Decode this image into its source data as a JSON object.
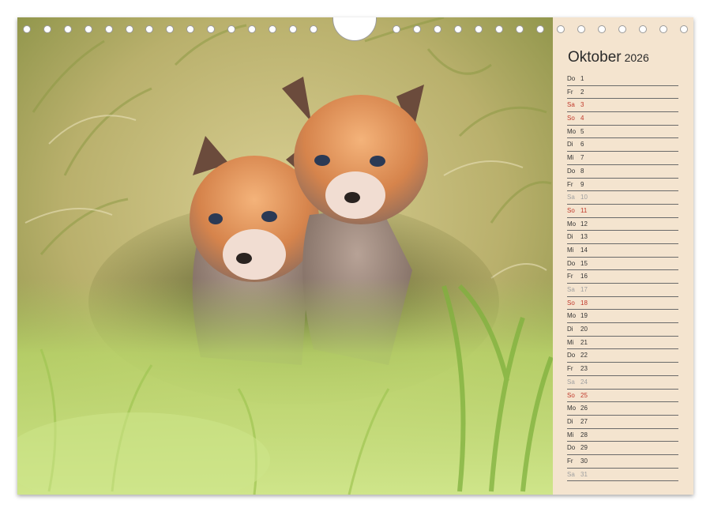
{
  "calendar": {
    "month": "Oktober",
    "year": "2026",
    "days": [
      {
        "wd": "Do",
        "n": "1",
        "t": "wk"
      },
      {
        "wd": "Fr",
        "n": "2",
        "t": "wk"
      },
      {
        "wd": "Sa",
        "n": "3",
        "t": "hol"
      },
      {
        "wd": "So",
        "n": "4",
        "t": "sun"
      },
      {
        "wd": "Mo",
        "n": "5",
        "t": "wk"
      },
      {
        "wd": "Di",
        "n": "6",
        "t": "wk"
      },
      {
        "wd": "Mi",
        "n": "7",
        "t": "wk"
      },
      {
        "wd": "Do",
        "n": "8",
        "t": "wk"
      },
      {
        "wd": "Fr",
        "n": "9",
        "t": "wk"
      },
      {
        "wd": "Sa",
        "n": "10",
        "t": "sat"
      },
      {
        "wd": "So",
        "n": "11",
        "t": "sun"
      },
      {
        "wd": "Mo",
        "n": "12",
        "t": "wk"
      },
      {
        "wd": "Di",
        "n": "13",
        "t": "wk"
      },
      {
        "wd": "Mi",
        "n": "14",
        "t": "wk"
      },
      {
        "wd": "Do",
        "n": "15",
        "t": "wk"
      },
      {
        "wd": "Fr",
        "n": "16",
        "t": "wk"
      },
      {
        "wd": "Sa",
        "n": "17",
        "t": "sat"
      },
      {
        "wd": "So",
        "n": "18",
        "t": "sun"
      },
      {
        "wd": "Mo",
        "n": "19",
        "t": "wk"
      },
      {
        "wd": "Di",
        "n": "20",
        "t": "wk"
      },
      {
        "wd": "Mi",
        "n": "21",
        "t": "wk"
      },
      {
        "wd": "Do",
        "n": "22",
        "t": "wk"
      },
      {
        "wd": "Fr",
        "n": "23",
        "t": "wk"
      },
      {
        "wd": "Sa",
        "n": "24",
        "t": "sat"
      },
      {
        "wd": "So",
        "n": "25",
        "t": "sun"
      },
      {
        "wd": "Mo",
        "n": "26",
        "t": "wk"
      },
      {
        "wd": "Di",
        "n": "27",
        "t": "wk"
      },
      {
        "wd": "Mi",
        "n": "28",
        "t": "wk"
      },
      {
        "wd": "Do",
        "n": "29",
        "t": "wk"
      },
      {
        "wd": "Fr",
        "n": "30",
        "t": "wk"
      },
      {
        "wd": "Sa",
        "n": "31",
        "t": "sat"
      }
    ]
  },
  "colors": {
    "panel": "#f4e4cf",
    "sunday": "#c0392b",
    "saturday": "#a0a0a0"
  }
}
